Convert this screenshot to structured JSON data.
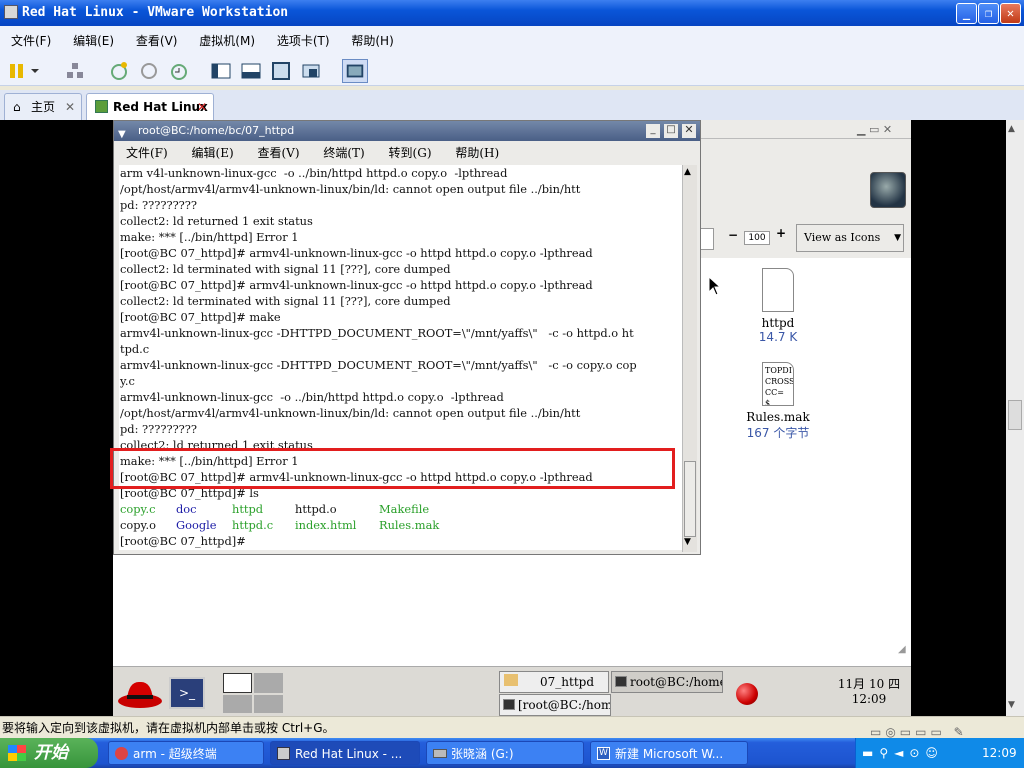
{
  "window": {
    "title": "Red Hat Linux - VMware Workstation"
  },
  "menubar": {
    "items": [
      "文件(F)",
      "编辑(E)",
      "查看(V)",
      "虚拟机(M)",
      "选项卡(T)",
      "帮助(H)"
    ]
  },
  "tabs": [
    {
      "label": "主页"
    },
    {
      "label": "Red Hat Linux"
    }
  ],
  "terminal": {
    "title": "root@BC:/home/bc/07_httpd",
    "menu": [
      "文件(F)",
      "编辑(E)",
      "查看(V)",
      "终端(T)",
      "转到(G)",
      "帮助(H)"
    ],
    "lines": [
      "arm v4l-unknown-linux-gcc  -o ../bin/httpd httpd.o copy.o  -lpthread",
      "/opt/host/armv4l/armv4l-unknown-linux/bin/ld: cannot open output file ../bin/htt",
      "pd: ?????????",
      "collect2: ld returned 1 exit status",
      "make: *** [../bin/httpd] Error 1",
      "[root@BC 07_httpd]# armv4l-unknown-linux-gcc -o httpd httpd.o copy.o -lpthread",
      "collect2: ld terminated with signal 11 [???], core dumped",
      "[root@BC 07_httpd]# armv4l-unknown-linux-gcc -o httpd httpd.o copy.o -lpthread",
      "collect2: ld terminated with signal 11 [???], core dumped",
      "[root@BC 07_httpd]# make",
      "armv4l-unknown-linux-gcc -DHTTPD_DOCUMENT_ROOT=\\\"/mnt/yaffs\\\"   -c -o httpd.o ht",
      "tpd.c",
      "armv4l-unknown-linux-gcc -DHTTPD_DOCUMENT_ROOT=\\\"/mnt/yaffs\\\"   -c -o copy.o cop",
      "y.c",
      "armv4l-unknown-linux-gcc  -o ../bin/httpd httpd.o copy.o  -lpthread",
      "/opt/host/armv4l/armv4l-unknown-linux/bin/ld: cannot open output file ../bin/htt",
      "pd: ?????????",
      "collect2: ld returned 1 exit status",
      "make: *** [../bin/httpd] Error 1",
      "[root@BC 07_httpd]# armv4l-unknown-linux-gcc -o httpd httpd.o copy.o -lpthread",
      "[root@BC 07_httpd]# ls"
    ],
    "ls_rows": [
      [
        {
          "t": "copy.c",
          "c": "#2aa02a"
        },
        {
          "t": "doc",
          "c": "#1a1aa6"
        },
        {
          "t": "httpd",
          "c": "#2aa02a"
        },
        {
          "t": "httpd.o",
          "c": "#111"
        },
        {
          "t": "Makefile",
          "c": "#2aa02a"
        }
      ],
      [
        {
          "t": "copy.o",
          "c": "#111"
        },
        {
          "t": "Google",
          "c": "#1a1aa6"
        },
        {
          "t": "httpd.c",
          "c": "#2aa02a"
        },
        {
          "t": "index.html",
          "c": "#2aa02a"
        },
        {
          "t": "Rules.mak",
          "c": "#2aa02a"
        }
      ]
    ],
    "prompt": "[root@BC 07_httpd]#"
  },
  "filemanager": {
    "zoom": "100",
    "view_as": "View as Icons",
    "files": [
      {
        "name": "httpd",
        "size": "14.7 K"
      },
      {
        "name": "Rules.mak",
        "size": "167 个字节",
        "preview": "TOPDI CROSS CC= $"
      }
    ]
  },
  "guest_taskbar": {
    "buttons": [
      "07_httpd",
      "root@BC:/home/b",
      "[root@BC:/home/"
    ],
    "clock": {
      "date": "11月 10 四",
      "time": "12:09"
    }
  },
  "statusbar": {
    "text": "要将输入定向到该虚拟机，请在虚拟机内部单击或按 Ctrl+G。"
  },
  "wintaskbar": {
    "start": "开始",
    "tasks": [
      "arm - 超级终端",
      "Red Hat Linux - ...",
      "张晓涵 (G:)",
      "新建 Microsoft W..."
    ],
    "time": "12:09"
  }
}
